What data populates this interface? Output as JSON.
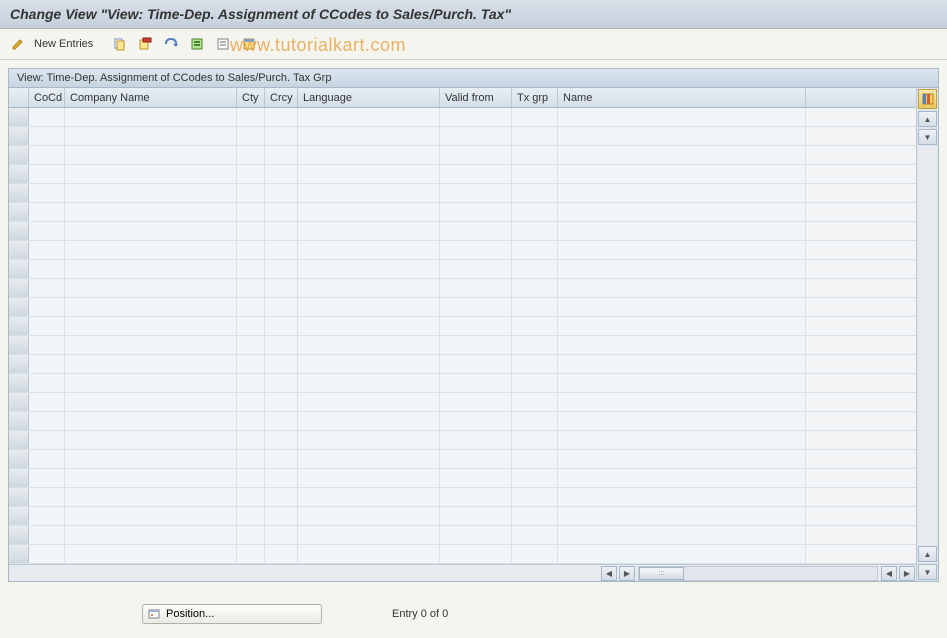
{
  "title": "Change View \"View: Time-Dep. Assignment of CCodes to Sales/Purch. Tax\"",
  "toolbar": {
    "new_entries_label": "New Entries"
  },
  "watermark": "www.tutorialkart.com",
  "panel": {
    "title": "View: Time-Dep. Assignment of CCodes to Sales/Purch. Tax Grp"
  },
  "columns": {
    "cocd": "CoCd",
    "cname": "Company Name",
    "cty": "Cty",
    "crcy": "Crcy",
    "lang": "Language",
    "valid": "Valid from",
    "txgrp": "Tx grp",
    "name": "Name"
  },
  "footer": {
    "position_label": "Position...",
    "entry_status": "Entry 0 of 0"
  }
}
